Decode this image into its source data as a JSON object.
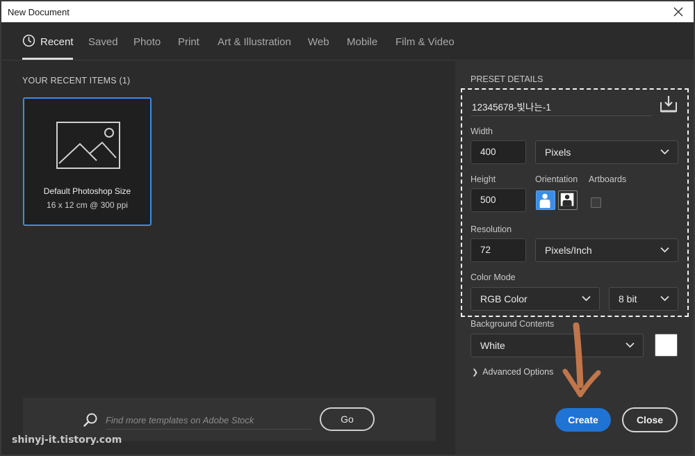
{
  "window": {
    "title": "New Document"
  },
  "tabs": [
    {
      "label": "Recent"
    },
    {
      "label": "Saved"
    },
    {
      "label": "Photo"
    },
    {
      "label": "Print"
    },
    {
      "label": "Art & Illustration"
    },
    {
      "label": "Web"
    },
    {
      "label": "Mobile"
    },
    {
      "label": "Film & Video"
    }
  ],
  "recent": {
    "title": "YOUR RECENT ITEMS  (1)",
    "items": [
      {
        "name": "Default Photoshop Size",
        "size": "16 x 12 cm @ 300 ppi"
      }
    ]
  },
  "stock": {
    "placeholder": "Find more templates on Adobe Stock",
    "go_label": "Go"
  },
  "watermark": "shinyj-it.tistory.com",
  "preset": {
    "section_label": "PRESET DETAILS",
    "name": "12345678-빛나는-1",
    "width_label": "Width",
    "width_value": "400",
    "width_unit": "Pixels",
    "height_label": "Height",
    "height_value": "500",
    "orientation_label": "Orientation",
    "artboards_label": "Artboards",
    "resolution_label": "Resolution",
    "resolution_value": "72",
    "resolution_unit": "Pixels/Inch",
    "color_mode_label": "Color Mode",
    "color_mode": "RGB Color",
    "bit_depth": "8 bit",
    "background_label": "Background Contents",
    "background": "White",
    "background_color": "#ffffff",
    "advanced_label": "Advanced Options"
  },
  "buttons": {
    "create": "Create",
    "close": "Close"
  },
  "colors": {
    "accent": "#1f73d4",
    "selected_border": "#3a8ee6",
    "annotation_arrow": "#c0764a"
  }
}
